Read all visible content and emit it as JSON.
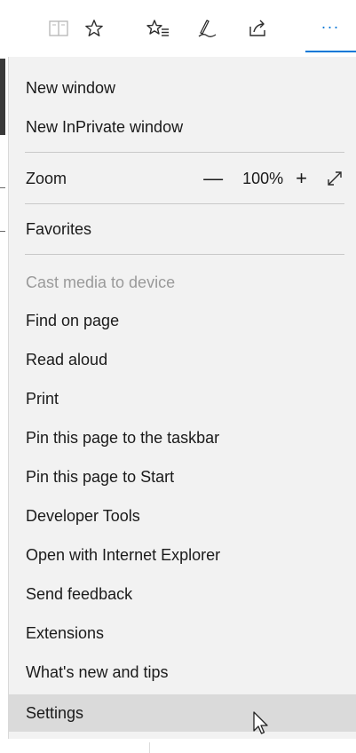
{
  "toolbar": {
    "icons": [
      {
        "name": "reading-view-icon"
      },
      {
        "name": "favorite-star-icon"
      },
      {
        "name": "favorites-hub-icon"
      },
      {
        "name": "web-note-pen-icon"
      },
      {
        "name": "share-icon"
      },
      {
        "name": "more-options-icon",
        "glyph": "···",
        "active": true
      }
    ],
    "accent_color": "#0078d7"
  },
  "menu": {
    "background": "#f2f2f2",
    "items": [
      {
        "label": "New window"
      },
      {
        "label": "New InPrivate window"
      },
      {
        "label": "Zoom"
      },
      {
        "label": "Favorites"
      },
      {
        "label": "Cast media to device",
        "disabled": true
      },
      {
        "label": "Find on page"
      },
      {
        "label": "Read aloud"
      },
      {
        "label": "Print"
      },
      {
        "label": "Pin this page to the taskbar"
      },
      {
        "label": "Pin this page to Start"
      },
      {
        "label": "Developer Tools"
      },
      {
        "label": "Open with Internet Explorer"
      },
      {
        "label": "Send feedback"
      },
      {
        "label": "Extensions"
      },
      {
        "label": "What's new and tips"
      },
      {
        "label": "Settings",
        "hovered": true
      }
    ],
    "zoom": {
      "minus": "—",
      "value": "100%",
      "plus": "+",
      "fullscreen_icon": "fullscreen-expand-icon"
    }
  }
}
